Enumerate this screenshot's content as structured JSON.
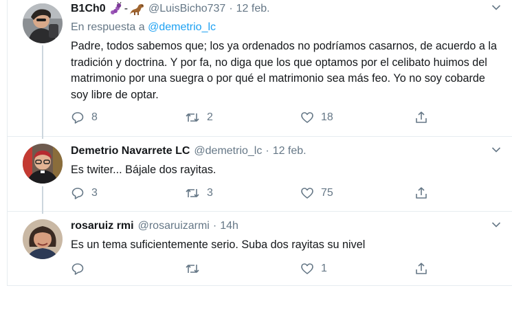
{
  "tweets": [
    {
      "name": "B1Ch0",
      "handle": "@LuisBicho737",
      "time": "12 feb.",
      "reply_prefix": "En respuesta a",
      "reply_mention": "@demetrio_lc",
      "text": "Padre, todos sabemos que; los ya ordenados no podríamos casarnos, de acuerdo a la tradición y doctrina. Y por fa, no diga que los que optamos por el celibato huimos del matrimonio por una suegra o por qué el matrimonio sea más feo. Yo no soy cobarde soy libre de optar.",
      "replies": "8",
      "retweets": "2",
      "likes": "18",
      "name_emoji": [
        "caterpillar-emoji",
        "dinosaur-emoji"
      ]
    },
    {
      "name": "Demetrio Navarrete LC",
      "handle": "@demetrio_lc",
      "time": "12 feb.",
      "text": "Es twiter...  Bájale dos rayitas.",
      "replies": "3",
      "retweets": "3",
      "likes": "75"
    },
    {
      "name": "rosaruiz rmi",
      "handle": "@rosaruizarmi",
      "time": "14h",
      "text": "Es un tema suficientemente serio. Suba dos rayitas su nivel",
      "replies": "",
      "retweets": "",
      "likes": "1"
    }
  ],
  "separator": "·",
  "colors": {
    "text_primary": "#14171a",
    "text_secondary": "#657786",
    "link": "#1da1f2",
    "border": "#e6ecf0",
    "thread_line": "#ccd6dd"
  },
  "icons": [
    "reply-icon",
    "retweet-icon",
    "like-icon",
    "share-icon",
    "chevron-down-icon"
  ]
}
